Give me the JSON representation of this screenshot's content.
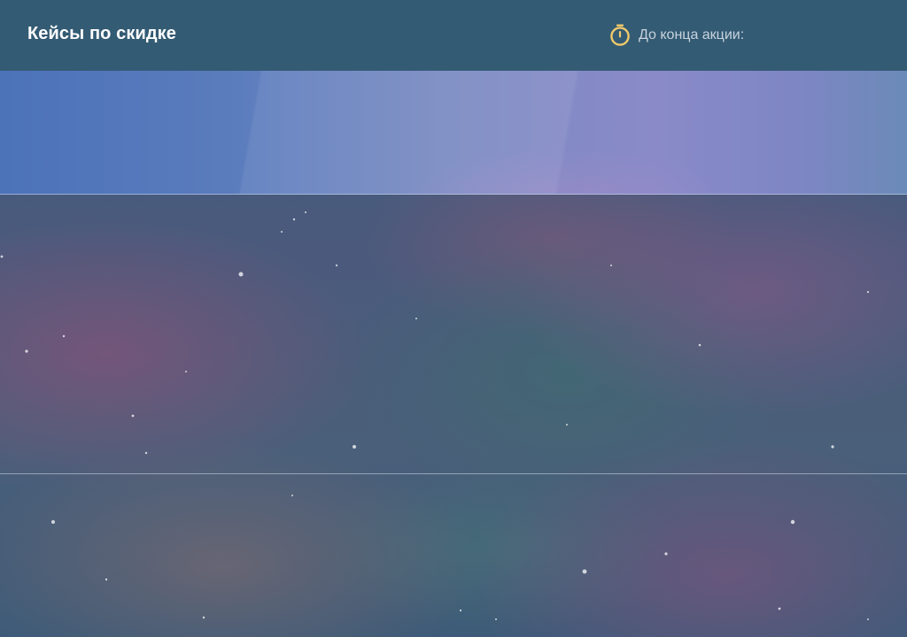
{
  "header": {
    "title": "Кейсы по скидке",
    "timer_label": "До конца акции:",
    "timer_icon": "stopwatch-icon",
    "accent_color": "#f0c96a",
    "background_color": "#345b74"
  },
  "banner": {
    "gradient_colors": [
      "#4c72b8",
      "#7a8ac2",
      "#8a8ac8",
      "#6b8ab8"
    ]
  }
}
